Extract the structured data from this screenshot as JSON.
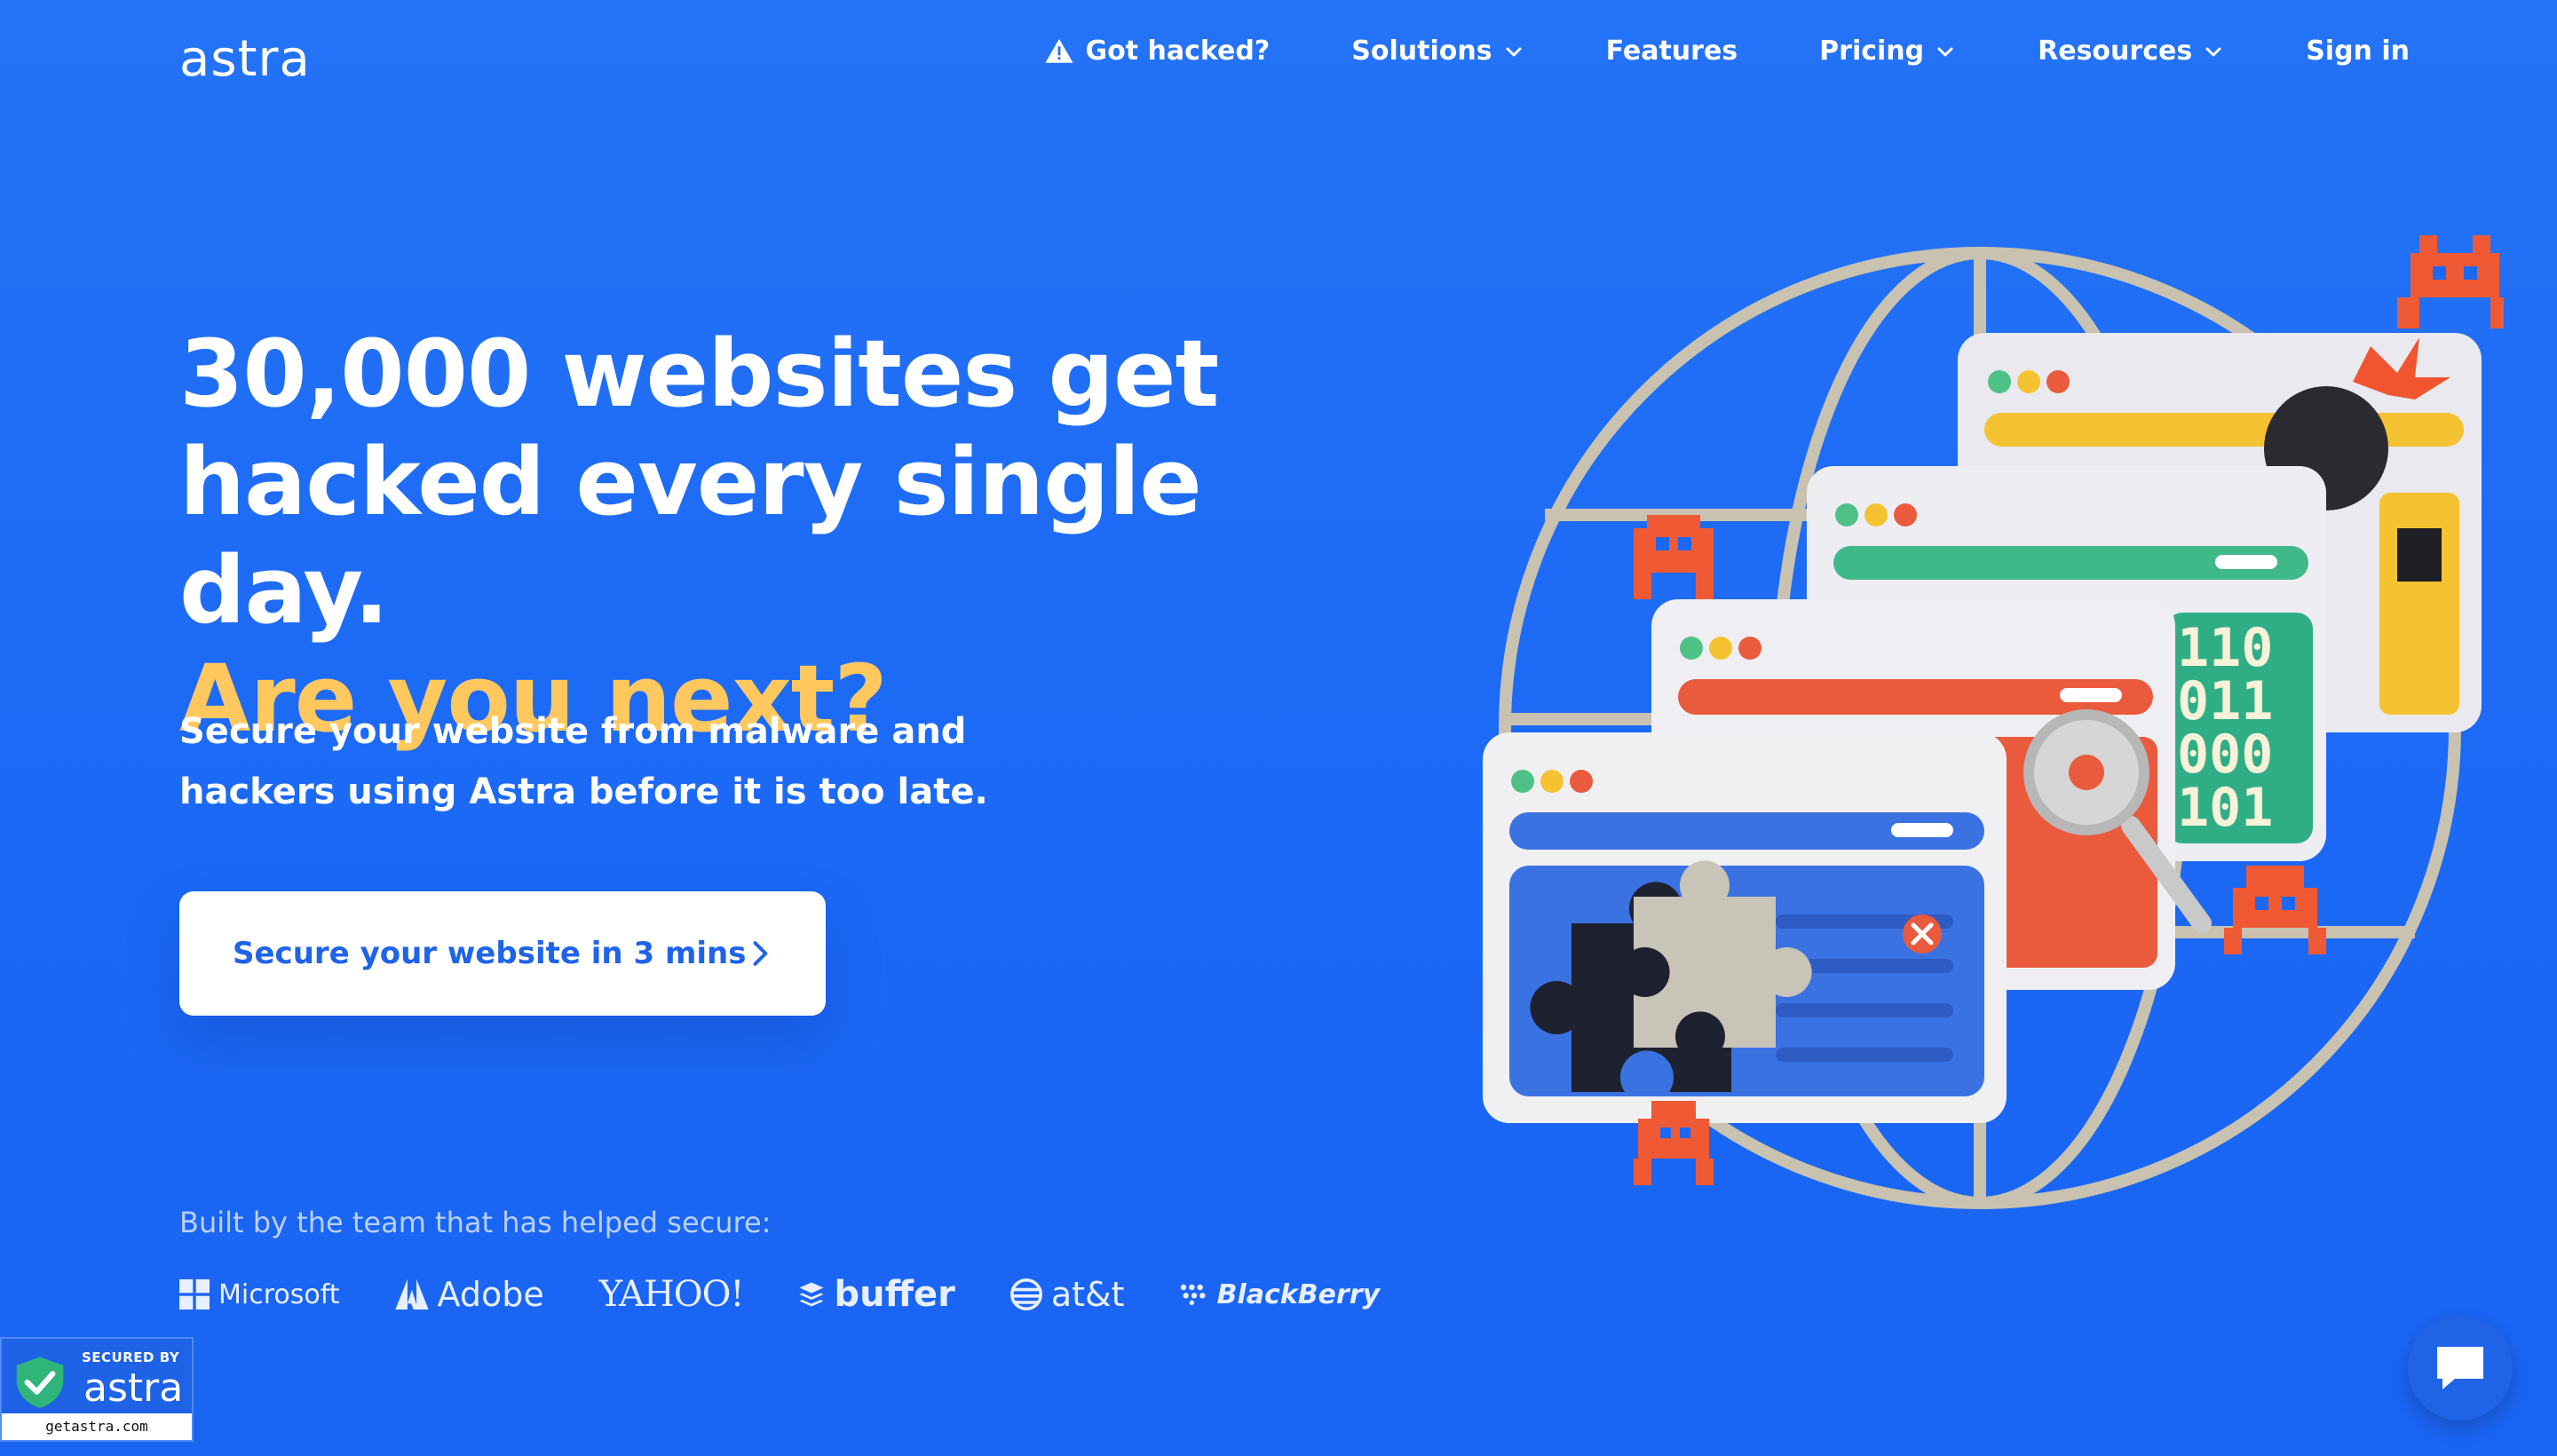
{
  "brand": {
    "logo_text": "astra"
  },
  "nav": {
    "items": [
      {
        "label": "Got hacked?",
        "icon": "warning-icon"
      },
      {
        "label": "Solutions",
        "icon": "chevron-down-icon"
      },
      {
        "label": "Features"
      },
      {
        "label": "Pricing",
        "icon": "chevron-down-icon"
      },
      {
        "label": "Resources",
        "icon": "chevron-down-icon"
      },
      {
        "label": "Sign in"
      }
    ]
  },
  "hero": {
    "title_line1": "30,000 websites get",
    "title_line2": "hacked every single day.",
    "title_accent": "Are you next?",
    "subtitle_line1": "Secure your website from malware and",
    "subtitle_line2": "hackers using Astra before it is too late.",
    "cta_label": "Secure your website in 3 mins"
  },
  "trusted": {
    "caption": "Built by the team that has helped secure:",
    "logos": [
      "Microsoft",
      "Adobe",
      "YAHOO!",
      "buffer",
      "at&t",
      "BlackBerry"
    ]
  },
  "badge": {
    "top": "SECURED BY",
    "word": "astra",
    "url": "getastra.com"
  },
  "illustration": {
    "binary_rows": [
      "110",
      "011",
      "000",
      "101"
    ]
  },
  "colors": {
    "background": "#1f6ef7",
    "accent_yellow": "#ffc85e",
    "cta_text": "#1e63e9",
    "caption": "#b9d0ff"
  }
}
